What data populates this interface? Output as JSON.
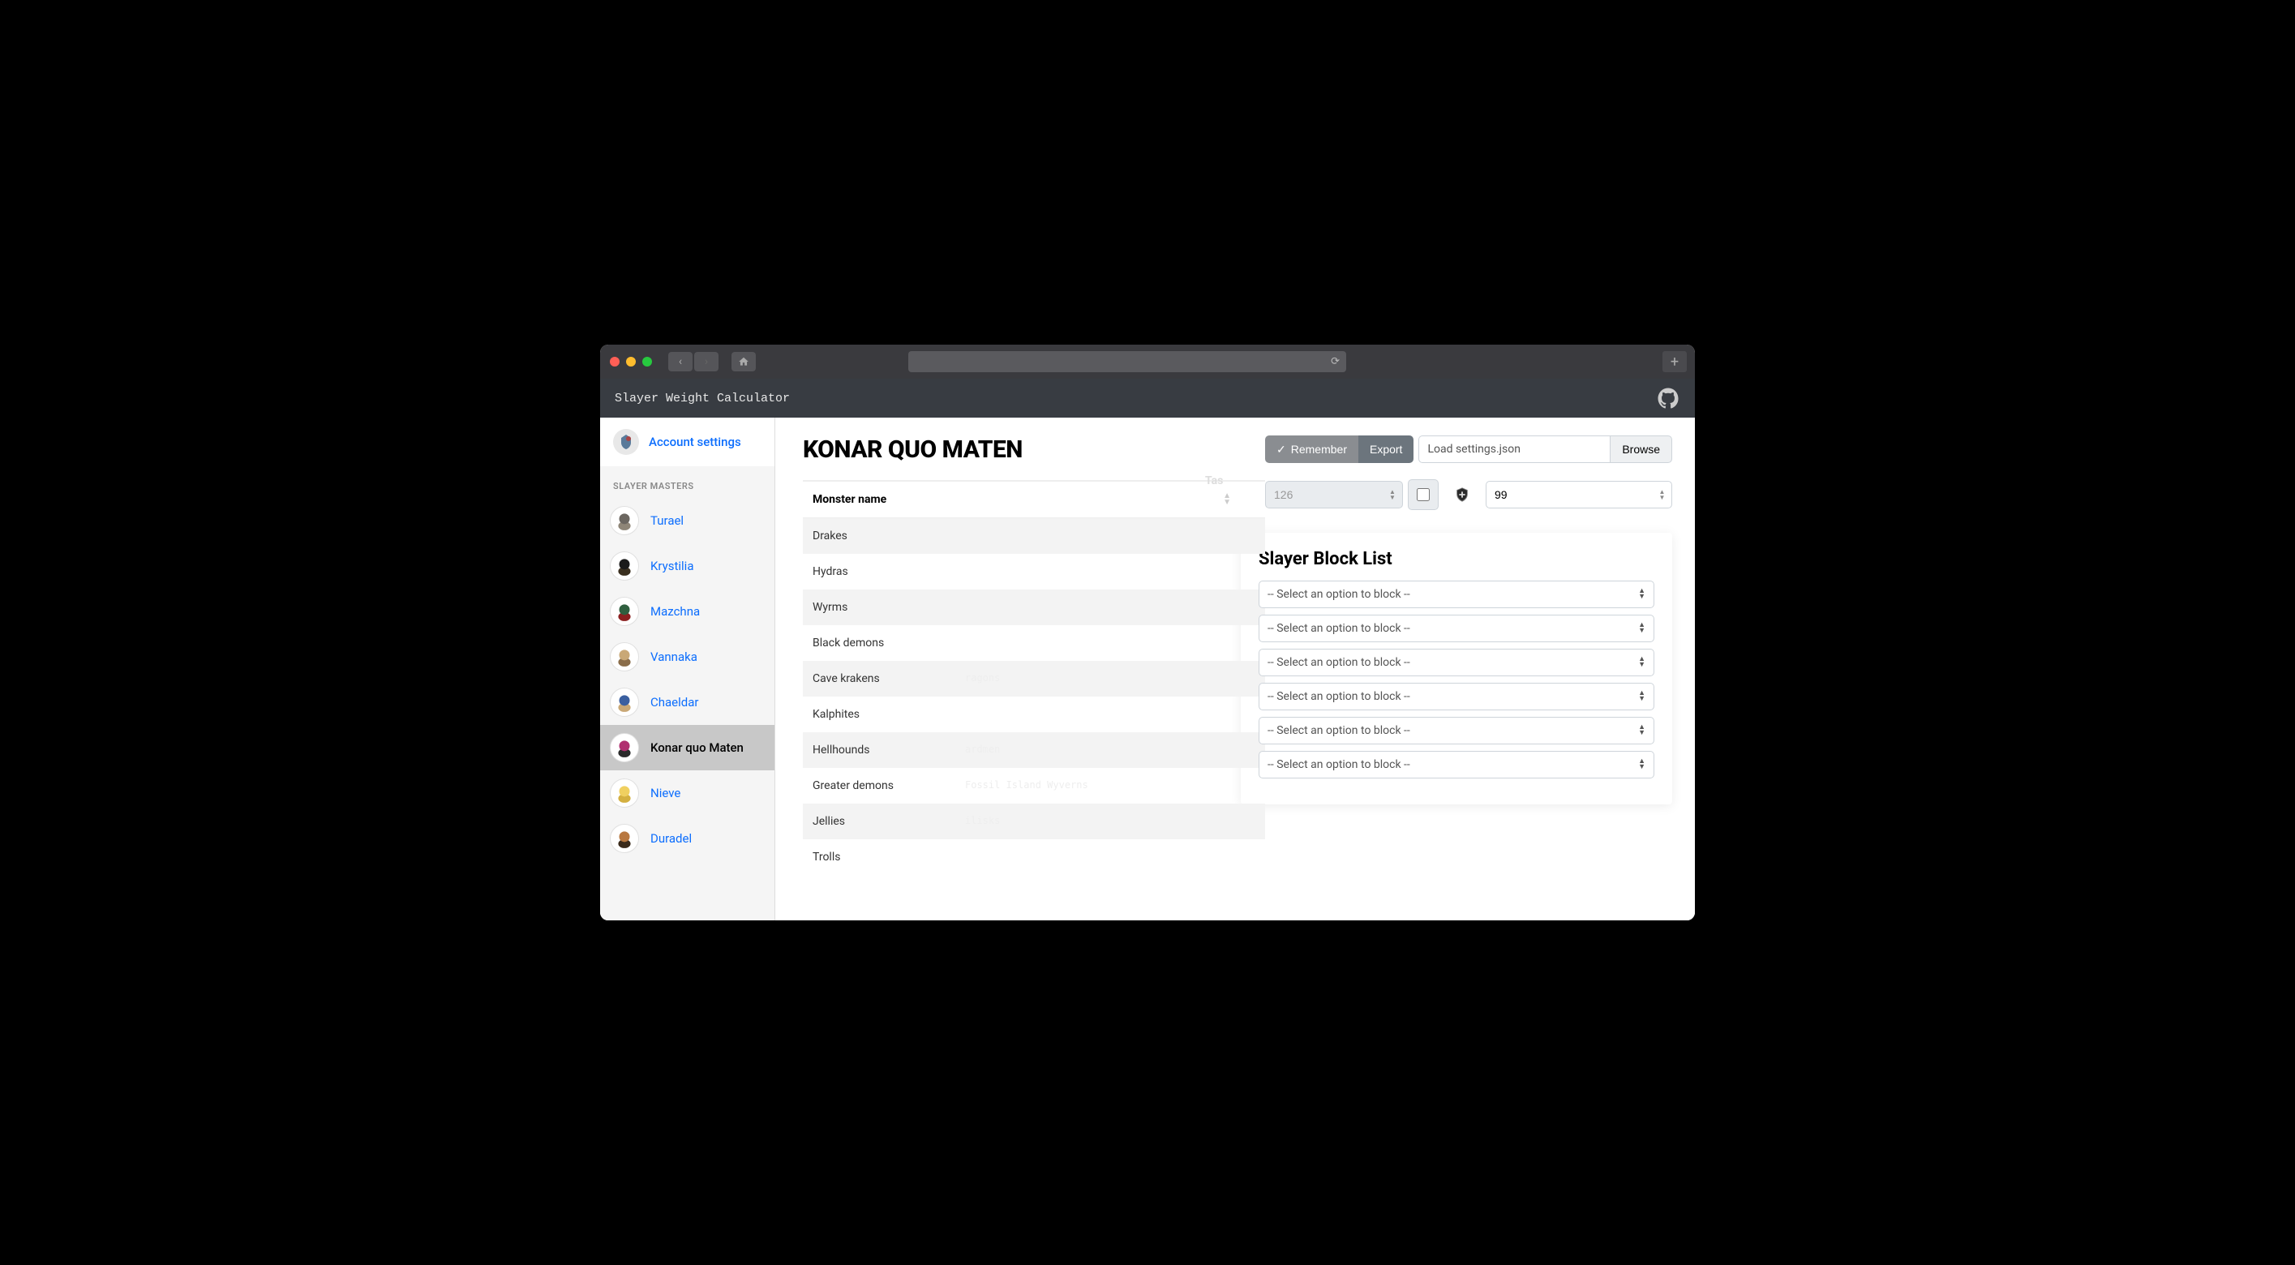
{
  "app": {
    "title": "Slayer Weight Calculator"
  },
  "sidebar": {
    "account_settings": "Account settings",
    "section_label": "SLAYER MASTERS",
    "masters": [
      {
        "name": "Turael",
        "active": false,
        "colors": [
          "#6b6660",
          "#8e8577"
        ]
      },
      {
        "name": "Krystilia",
        "active": false,
        "colors": [
          "#1a1a1a",
          "#3a2f1f"
        ]
      },
      {
        "name": "Mazchna",
        "active": false,
        "colors": [
          "#2f5f3f",
          "#8b2020"
        ]
      },
      {
        "name": "Vannaka",
        "active": false,
        "colors": [
          "#c9a876",
          "#8a6d4a"
        ]
      },
      {
        "name": "Chaeldar",
        "active": false,
        "colors": [
          "#3a5fa0",
          "#c9a876"
        ]
      },
      {
        "name": "Konar quo Maten",
        "active": true,
        "colors": [
          "#b03070",
          "#2a2a2a"
        ]
      },
      {
        "name": "Nieve",
        "active": false,
        "colors": [
          "#f0d060",
          "#d4b040"
        ]
      },
      {
        "name": "Duradel",
        "active": false,
        "colors": [
          "#b87840",
          "#3a2a1a"
        ]
      }
    ]
  },
  "main": {
    "title": "KONAR QUO MATEN",
    "col_monster": "Monster name",
    "col_spill": "Tas",
    "monsters": [
      "Drakes",
      "Hydras",
      "Wyrms",
      "Black demons",
      "Cave krakens",
      "Kalphites",
      "Hellhounds",
      "Greater demons",
      "Jellies",
      "Trolls"
    ],
    "ghost_hints": {
      "4": "ragons",
      "6": "ardmen",
      "7": "Fossil Island Wyverns",
      "8": "ilisks"
    }
  },
  "toolbar": {
    "remember": "Remember",
    "export": "Export",
    "file_placeholder": "Load settings.json",
    "browse": "Browse"
  },
  "stats": {
    "points_value": "126",
    "level_value": "99"
  },
  "block_panel": {
    "title": "Slayer Block List",
    "placeholder": "-- Select an option to block --",
    "slots": 6
  }
}
